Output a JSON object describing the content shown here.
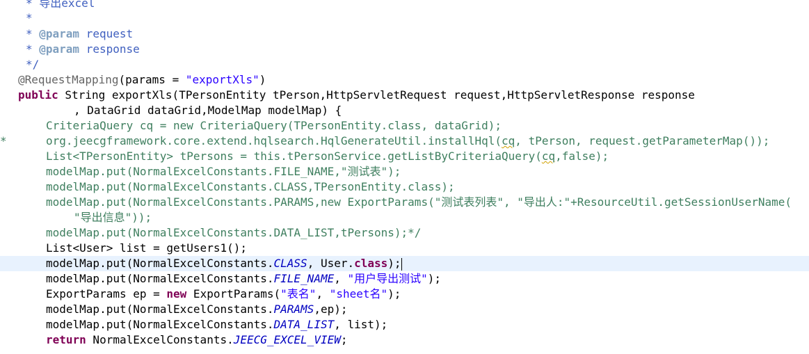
{
  "editor": {
    "lines": {
      "l1": "* 导出excel",
      "l2": "*",
      "l3a": "* ",
      "l3b": "@param",
      "l3c": " request",
      "l4a": "* ",
      "l4b": "@param",
      "l4c": " response",
      "l5": "*/",
      "l6a": "@RequestMapping",
      "l6b": "(params = ",
      "l6c": "\"exportXls\"",
      "l6d": ")",
      "l7a": "public",
      "l7b": " String exportXls(TPersonEntity tPerson,HttpServletRequest request,HttpServletResponse response",
      "l8": ", DataGrid dataGrid,ModelMap modelMap) {",
      "l9": "CriteriaQuery cq = new CriteriaQuery(TPersonEntity.class, dataGrid);",
      "l10a": "org.jeecgframework.core.extend.hqlsearch.HqlGenerateUtil.installHql(",
      "l10b": "cq",
      "l10c": ", tPerson, request.getParameterMap());",
      "l11a": "List<TPersonEntity> tPersons = this.tPersonService.getListByCriteriaQuery(",
      "l11b": "cq",
      "l11c": ",false);",
      "l12": "modelMap.put(NormalExcelConstants.FILE_NAME,\"测试表\");",
      "l13": "modelMap.put(NormalExcelConstants.CLASS,TPersonEntity.class);",
      "l14": "modelMap.put(NormalExcelConstants.PARAMS,new ExportParams(\"测试表列表\", \"导出人:\"+ResourceUtil.getSessionUserName(",
      "l15": "\"导出信息\"));",
      "l16": "modelMap.put(NormalExcelConstants.DATA_LIST,tPersons);*/",
      "l17": "List<User> list = getUsers1();",
      "l18a": "modelMap.put(NormalExcelConstants.",
      "l18b": "CLASS",
      "l18c": ", User.",
      "l18d": "class",
      "l18e": ");",
      "l19a": "modelMap.put(NormalExcelConstants.",
      "l19b": "FILE_NAME",
      "l19c": ", ",
      "l19d": "\"用户导出测试\"",
      "l19e": ");",
      "l20a": "ExportParams ep = ",
      "l20b": "new",
      "l20c": " ExportParams(",
      "l20d": "\"表名\"",
      "l20e": ", ",
      "l20f": "\"sheet名\"",
      "l20g": ");",
      "l21a": "modelMap.put(NormalExcelConstants.",
      "l21b": "PARAMS",
      "l21c": ",ep);",
      "l22a": "modelMap.put(NormalExcelConstants.",
      "l22b": "DATA_LIST",
      "l22c": ", list);",
      "l23a": "return",
      "l23b": " NormalExcelConstants.",
      "l23c": "JEECG_EXCEL_VIEW",
      "l23d": ";"
    },
    "gutter_marker": "*"
  },
  "colors": {
    "comment": "#3f7f5f",
    "javadoc": "#3f5fbf",
    "keyword": "#7f0055",
    "string": "#2a00ff",
    "field": "#0000c0",
    "current_line": "#e8f2fe"
  }
}
